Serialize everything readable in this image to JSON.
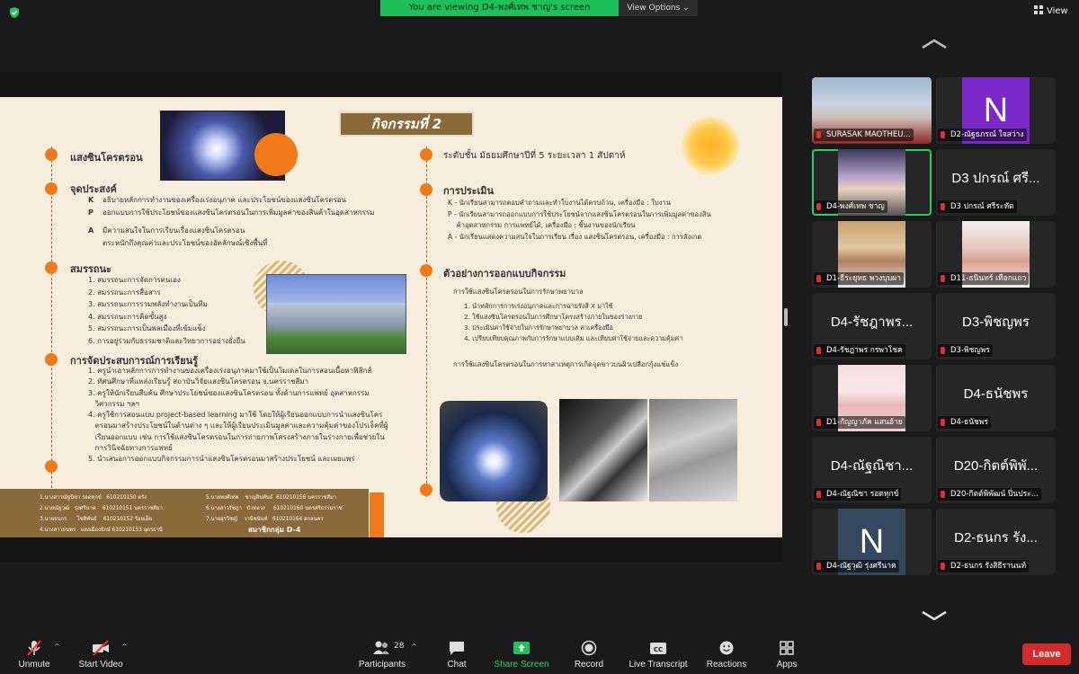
{
  "top": {
    "banner": "You are viewing D4-พงศ์เทพ ชาญ's screen",
    "view_options": "View Options",
    "view": "View"
  },
  "slide": {
    "title": "กิจกรรมที่ 2",
    "left": {
      "topic": "แสงซินโครตรอน",
      "objective_h": "จุดประสงค์",
      "objectives": [
        {
          "k": "K",
          "text": "อธิบายหลักการทำงานของเครื่องเร่งอนุภาค และประโยชน์ของแสงซินโครตรอน"
        },
        {
          "k": "P",
          "text": "ออกแบบการใช้ประโยชน์ของแสงซินโครตรอนในการเพิ่มมูลค่าของสินค้าในอุตสาหกรรม"
        },
        {
          "k": "A",
          "text": "มีความสนใจในการเรียนเรื่องแสงซินโครตรอน"
        },
        {
          "k": "",
          "text": "ตระหนักถึงคุณค่าและประโยชน์ของอัตลักษณ์เชิงพื้นที่"
        }
      ],
      "competency_h": "สมรรถนะ",
      "competencies": [
        "1. สมรรถนะการจัดการตนเอง",
        "2. สมรรถนะการสื่อสาร",
        "3. สมรรถนะการรวมพลังทำงานเป็นทีม",
        "4. สมรรถนะการคิดขั้นสูง",
        "5. สมรรถนะการเป็นพลเมืองที่เข้มแข็ง",
        "6. การอยู่ร่วมกับธรรมชาติและวิทยาการอย่างยั่งยืน"
      ],
      "learning_h": "การจัดประสบการณ์การเรียนรู้",
      "learning": [
        "1. ครูนำเอาหลักการการทำงานของเครื่องเร่งอนุภาคมาใช้เป็นโมเดลในการสอนเนื้อหาฟิสิกส์",
        "2. ทัศนศึกษาที่แหล่งเรียนรู้ สถาบันวิจัยแสงซินโครตรอน จ.นครราชสีมา",
        "3. ครูให้นักเรียนสืบค้น ศึกษาประโยชน์ของแสงซินโครตรอน ทั้งด้านการแพทย์ อุตสาหกรรม",
        "   วิศวกรรม ฯลฯ",
        "4. ครูใช้การสอนแบบ project-based learning มาใช้ โดยให้ผู้เรียนออกแบบการนำแสงซินโคร",
        "   ตรอนมาสร้างประโยชน์ในด้านต่าง ๆ และให้ผู้เรียนประเมินมูลค่าและความคุ้มค่าของโปรเจ็คที่ผู้",
        "   เรียนออกแบบ เช่น การใช้แสงซินโครตรอนในการถ่ายภาพโครงสร้างภายในร่างกายเพื่อช่วยใน",
        "   การวินิจฉัยทางการแพทย์",
        "5. นำเสนอการออกแบบกิจกรรมการนำแสงซินโครตรอนมาสร้างประโยชน์ และเผยแพร่"
      ],
      "members_label": "สมาชิกกลุ่ม D-4",
      "members": [
        "1.นางสาวณัฐนิชา รอดทุกข์   610210150 ตรัง",
        "2.นายณัฐวุฒิ   รุ่งศรีนาค    610210151 นครราชสีมา",
        "3.นายธนกร      โชติพันธ์    610210152 ร้อยเอ็ด",
        "4.นางสาวธนพร   แสงเมืองปักษ์ 610210153 อุดรธานี",
        "5.นายพงศ์เทพ    ชาญสินพันธ์  610210156 นครราชสีมา",
        "6.นางสาวรัชฎา   บัวหลวง     610210160 นครศรีธรรมราช",
        "7.นายสุรวิชญ์    วานิชนันท์   610210164 สกลนคร"
      ]
    },
    "right": {
      "level": "ระดับชั้น มัธยมศึกษาปีที่ 5 ระยะเวลา 1 สัปดาห์",
      "assess_h": "การประเมิน",
      "assess": [
        "K - นักเรียนสามารถตอบคำถามและทำใบงานได้ครบถ้วน, เครื่องมือ : ใบงาน",
        "P - นักเรียนสามารถออกแบบการใช้ประโยชน์จากแสงซินโครตรอนในการเพิ่มมูลค่าของสิน",
        "    ค้าอุตสาหกรรม การแพทย์ได้, เครื่องมือ : ชิ้นงานของนักเรียน",
        "A - นักเรียนแสดงความสนใจในการเรียน เรื่อง แสงซินโครตรอน, เครื่องมือ : การสังเกต"
      ],
      "example_h": "ตัวอย่างการออกแบบกิจกรรม",
      "example_sub": "การใช้แสงซินโครตรอนในการรักษาพยาบาล",
      "example_items": [
        "1. นำหลักการการเร่งอนุภาคและการฉายรังสี X มาใช้",
        "2. ใช้แสงซินโครตรอนในการศึกษาโครงสร้างภายในของร่างกาย",
        "3. ประเมินค่าใช้จ่ายในการรักษาพยาบาล ค่าเครื่องมือ",
        "4. เปรียบเทียบคุณภาพกับการรักษาแบบเดิม และเทียบค่าใช้จ่ายและความคุ้มค่า"
      ],
      "example_sub2": "การใช้แสงซินโครตรอนในการหาสาเหตุการเกิดจุดขาวบนผิวเปลือกกุ้งแช่แข็ง"
    }
  },
  "gallery": [
    {
      "type": "video",
      "cap": "SURASAK MAOTHEU..."
    },
    {
      "type": "letter",
      "letter": "N",
      "cap": "D2-ณัฐธภรณ์ ใจสว่าง"
    },
    {
      "type": "video",
      "cap": "D4-พงศ์เทพ ชาญ",
      "active": true
    },
    {
      "type": "name",
      "big": "D3 ปกรณ์ ศรี...",
      "cap": "D3 ปกรณ์ ศรีระทัต"
    },
    {
      "type": "video",
      "cap": "D1-ธีระยุทธ พวงบุบผา"
    },
    {
      "type": "video",
      "cap": "D11-ธนินทร์ เทือกแถว"
    },
    {
      "type": "name",
      "big": "D4-รัชฎาพร...",
      "cap": "D4-รัชฎาพร กรพาโชค"
    },
    {
      "type": "name",
      "big": "D3-พิชญพร",
      "cap": "D3-พิชญพร"
    },
    {
      "type": "video",
      "cap": "D1-กัญญาภัค แสนอ้าย"
    },
    {
      "type": "name",
      "big": "D4-ธนัชพร",
      "cap": "D4-ธนัชพร"
    },
    {
      "type": "name",
      "big": "D4-ณัฐณิชา...",
      "cap": "D4-ณัฐณิชา รอดทุกข์"
    },
    {
      "type": "name",
      "big": "D20-กิตต์พิพั...",
      "cap": "D20-กิตต์พิพัฒน์ ปิ่นประ..."
    },
    {
      "type": "letter",
      "letter": "N",
      "cap": "D4-ณัฐวุฒิ รุ่งศรีนาค"
    },
    {
      "type": "name",
      "big": "D2-ธนกร รัง...",
      "cap": "D2-ธนกร รังสิธีรานนท์"
    }
  ],
  "toolbar": {
    "unmute": "Unmute",
    "start_video": "Start Video",
    "participants": "Participants",
    "participants_count": "28",
    "chat": "Chat",
    "share_screen": "Share Screen",
    "record": "Record",
    "live_transcript": "Live Transcript",
    "reactions": "Reactions",
    "apps": "Apps",
    "leave": "Leave"
  },
  "colors": {
    "accent_green": "#1fbf5a",
    "leave_red": "#d42b2b",
    "slide_orange": "#f07a1a",
    "slide_bg": "#f7eddc"
  }
}
